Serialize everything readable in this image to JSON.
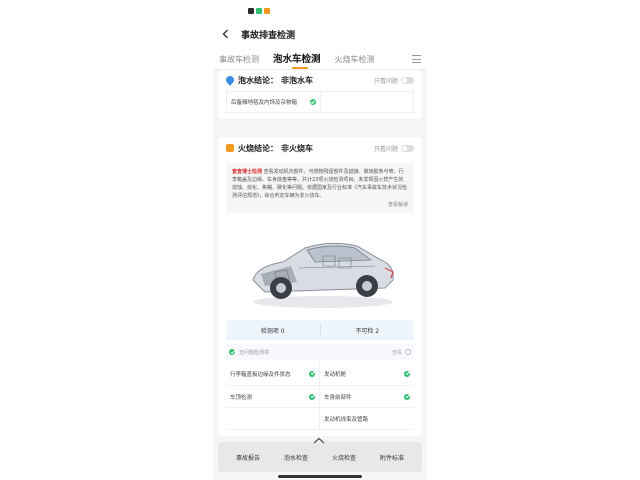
{
  "header": {
    "title": "事故排查检测"
  },
  "tabs": [
    {
      "label": "事故车检测",
      "active": false
    },
    {
      "label": "泡水车检测",
      "active": true
    },
    {
      "label": "火烧车检测",
      "active": false
    }
  ],
  "water": {
    "label": "泡水结论：",
    "value": "非泡水车",
    "toggle_label": "只看问题",
    "sub_item_label": "后备厢地毯及内饰及杂物箱"
  },
  "fire": {
    "label": "火烧结论：",
    "value": "非火烧车",
    "toggle_label": "只看问题",
    "desc_brand": "查查博士检测",
    "desc_text": "查看发动机内部件、可燃物残留部件及插接、玻璃胶条与喷、行李箱盖及边缘、车身底盘等等，共计23项火烧检测项目。未发现因火焚产生的烧蚀、熔化、焦糊、碳化等问题。依据国家及行业标准《汽车事故车技术状况检测评估规范》，综合判定车辆为非火烧车。",
    "more": "查看解读"
  },
  "stats": {
    "normal": "检测项 0",
    "abnormal": "不可检 2"
  },
  "normal_row": {
    "label": "无问题检测项",
    "side": "查看"
  },
  "items": [
    {
      "label": "行李箱盖板边缘及件状态",
      "ok": true
    },
    {
      "label": "发动机舱",
      "ok": true
    },
    {
      "label": "车顶检测",
      "ok": true
    },
    {
      "label": "车身前部件",
      "ok": true
    },
    {
      "label": "",
      "ok": false
    },
    {
      "label": "发动机线束及管路",
      "ok": false
    }
  ],
  "bottom_nav": [
    "事故报告",
    "泡水检查",
    "火烧检查",
    "附件标准"
  ],
  "colors": {
    "accent": "#f29a1f",
    "ok": "#2fbf71",
    "stats_bg": "#eef5fd"
  }
}
